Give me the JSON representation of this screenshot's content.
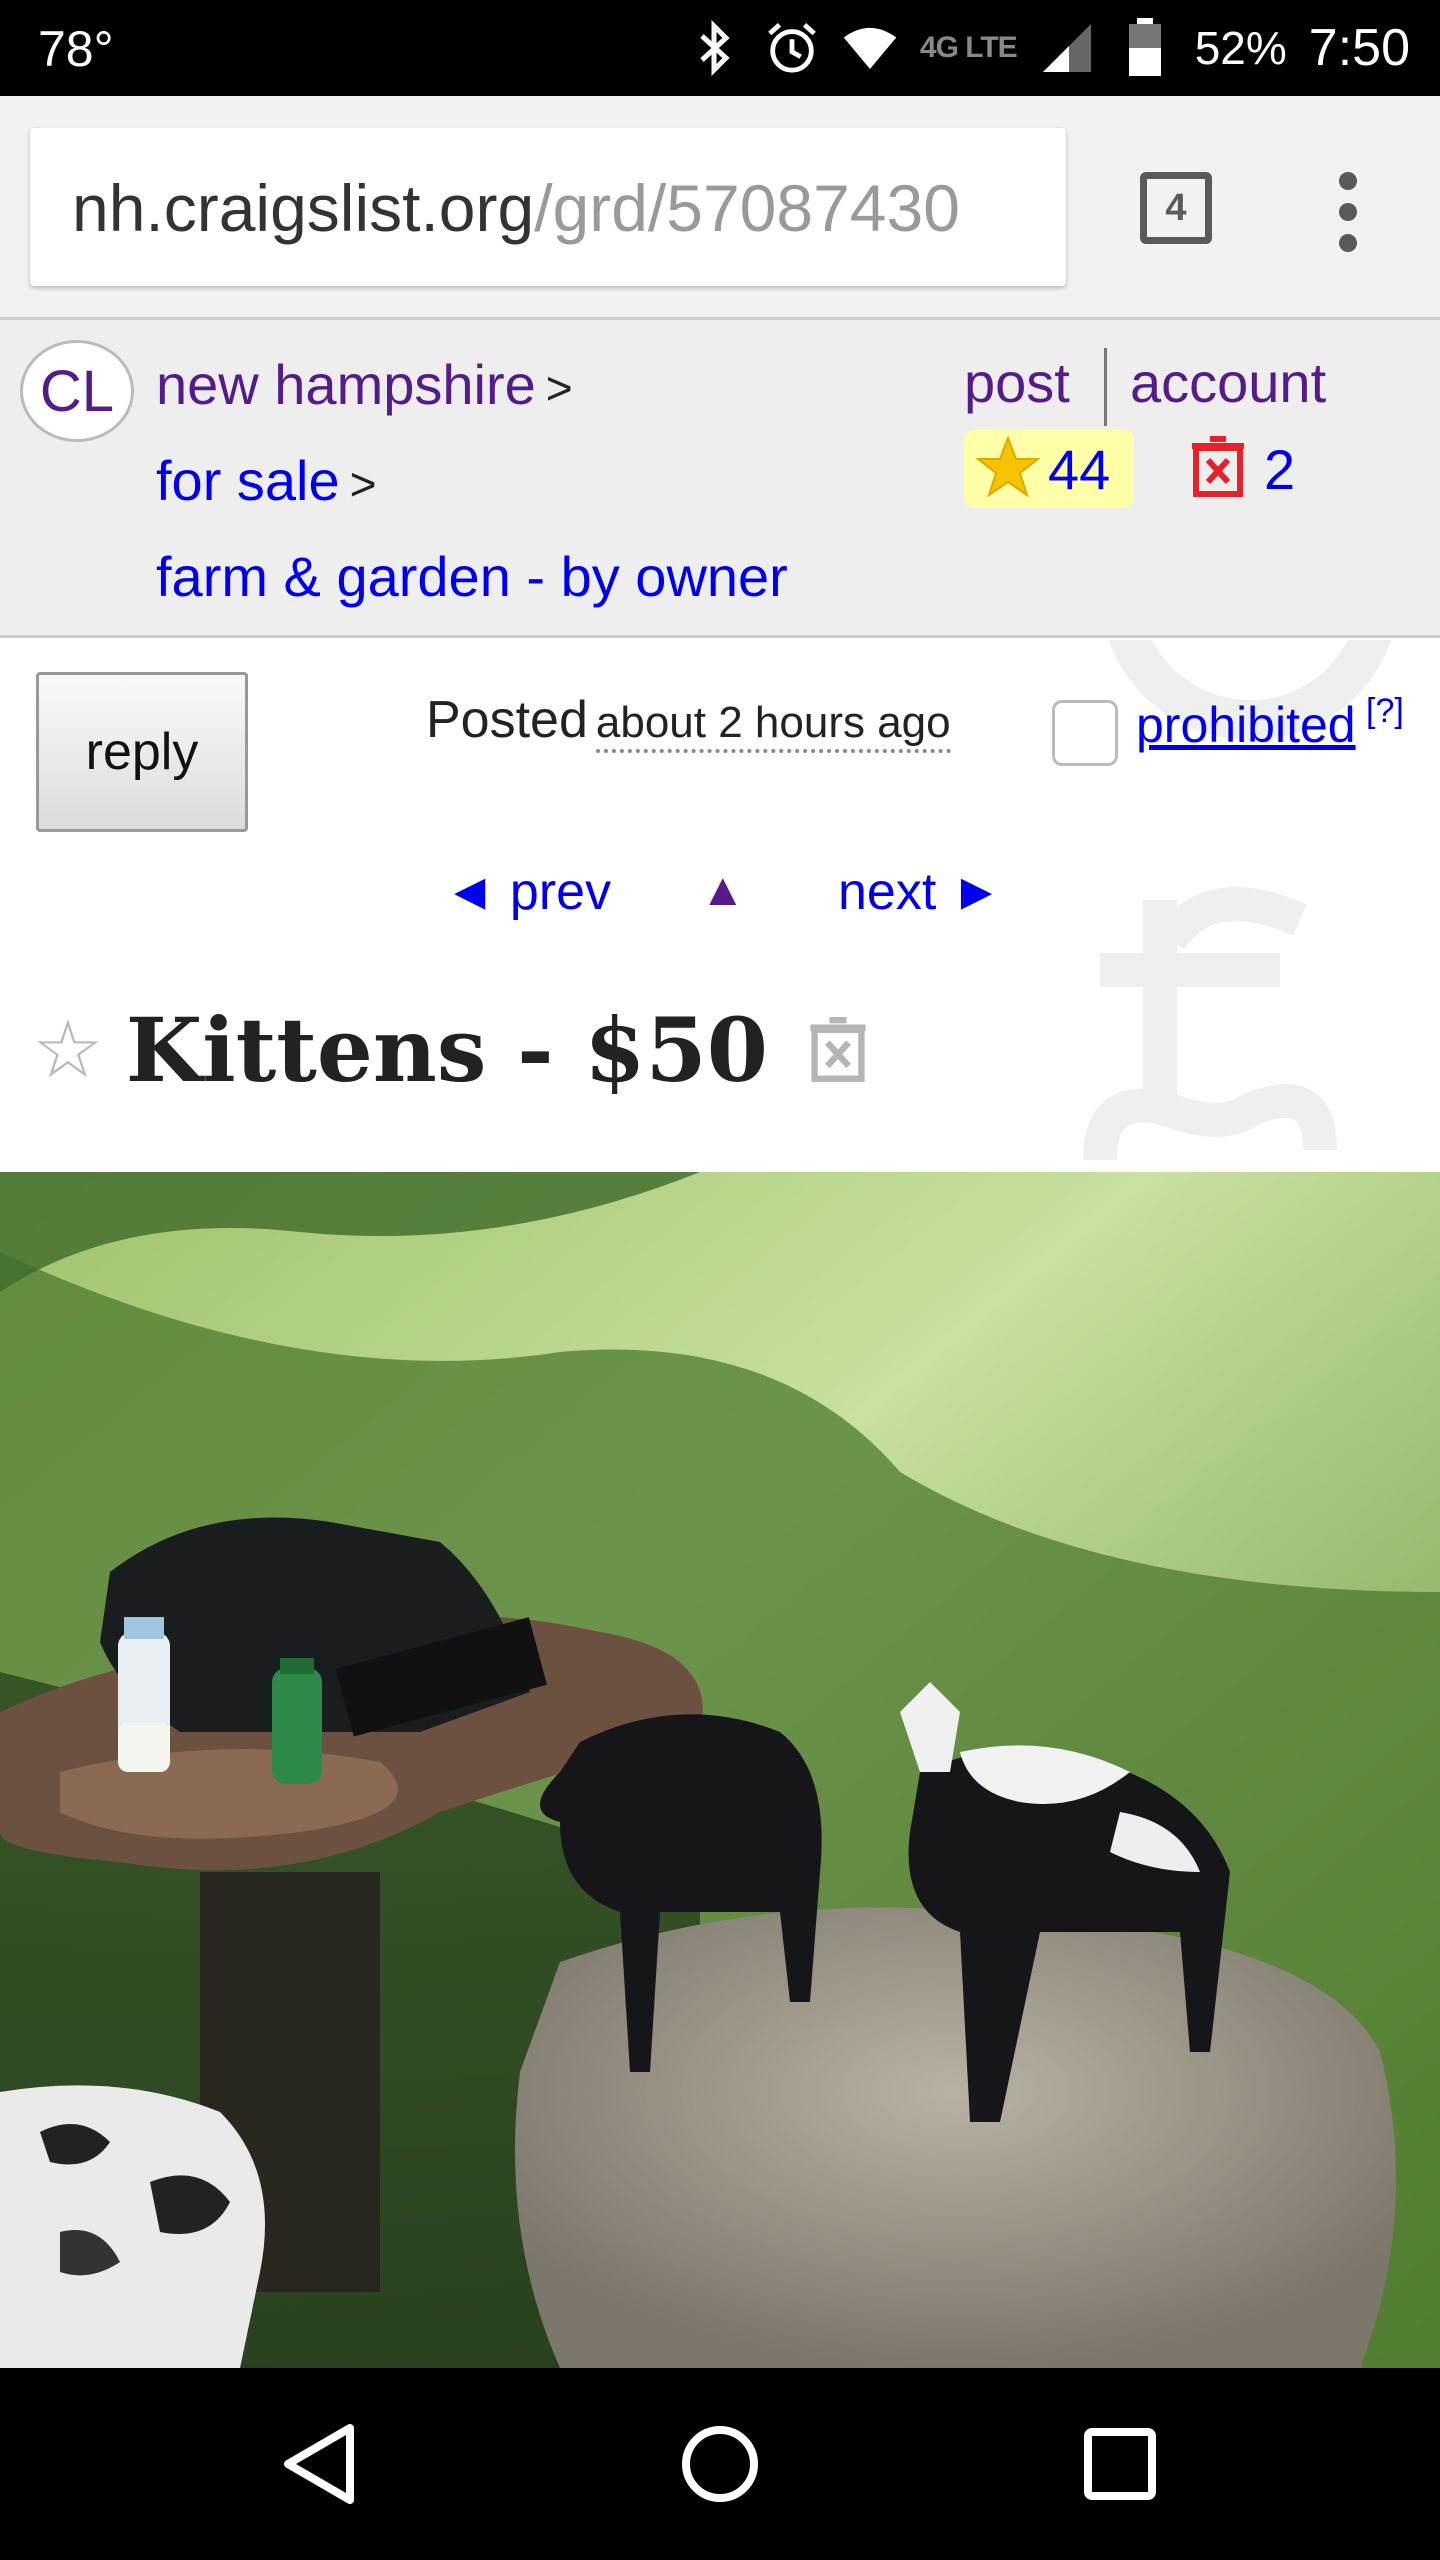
{
  "status_bar": {
    "temperature": "78°",
    "network": "4G LTE",
    "battery": "52%",
    "time": "7:50",
    "icons": [
      "bluetooth-icon",
      "alarm-icon",
      "wifi-icon",
      "signal-icon",
      "battery-icon"
    ]
  },
  "browser": {
    "url_domain": "nh.craigslist.org",
    "url_path": "/grd/57087430",
    "tab_count": "4",
    "menu_icon": "more-vert-icon"
  },
  "header": {
    "logo": "CL",
    "breadcrumbs": [
      {
        "label": "new hampshire",
        "sep": ">"
      },
      {
        "label": "for sale",
        "sep": ">"
      },
      {
        "label": "farm & garden - by owner"
      }
    ],
    "post_label": "post",
    "account_label": "account",
    "favorites_count": "44",
    "hidden_count": "2",
    "colors": {
      "visited": "#551a8b",
      "link": "#0000ee",
      "fav_bg": "#ffffa8",
      "hide_red": "#e8202a"
    }
  },
  "posting": {
    "reply_label": "reply",
    "posted_label": "Posted",
    "posted_ago": "about 2 hours ago",
    "prohibited_label": "prohibited",
    "help_label": "[?]",
    "nav": {
      "prev": "◄ prev",
      "up": "▲",
      "next": "next ►"
    },
    "title": "Kittens - $50"
  },
  "system_nav": {
    "icons": [
      "back-icon",
      "home-icon",
      "recents-icon"
    ]
  }
}
